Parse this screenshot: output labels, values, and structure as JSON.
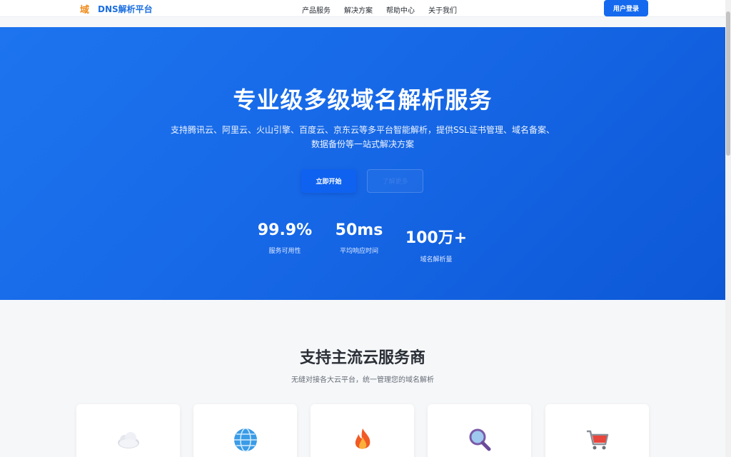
{
  "header": {
    "logo_mark": "域",
    "logo_text": "DNS解析平台",
    "nav": [
      "产品服务",
      "解决方案",
      "帮助中心",
      "关于我们"
    ],
    "login_label": "用户登录"
  },
  "hero": {
    "title": "专业级多级域名解析服务",
    "desc_line1": "支持腾讯云、阿里云、火山引擎、百度云、京东云等多平台智能解析，提供SSL证书管理、域名备案、",
    "desc_line2": "数据备份等一站式解决方案",
    "primary_button": "立即开始",
    "secondary_button": "了解更多",
    "stats": [
      {
        "value": "99.9%",
        "label": "服务可用性"
      },
      {
        "value": "50ms",
        "label": "平均响应时间"
      },
      {
        "value": "100万+",
        "label": "域名解析量"
      }
    ]
  },
  "providers": {
    "title": "支持主流云服务商",
    "subtitle": "无缝对接各大云平台，统一管理您的域名解析",
    "cards": [
      {
        "icon": "cloud-icon"
      },
      {
        "icon": "globe-icon"
      },
      {
        "icon": "fire-icon"
      },
      {
        "icon": "magnifier-icon"
      },
      {
        "icon": "shopping-cart-icon"
      }
    ]
  },
  "colors": {
    "brand_blue": "#1469ee",
    "logo_orange": "#f08a19",
    "hero_gradient_start": "#1d74ee",
    "hero_gradient_end": "#0d58d6"
  }
}
